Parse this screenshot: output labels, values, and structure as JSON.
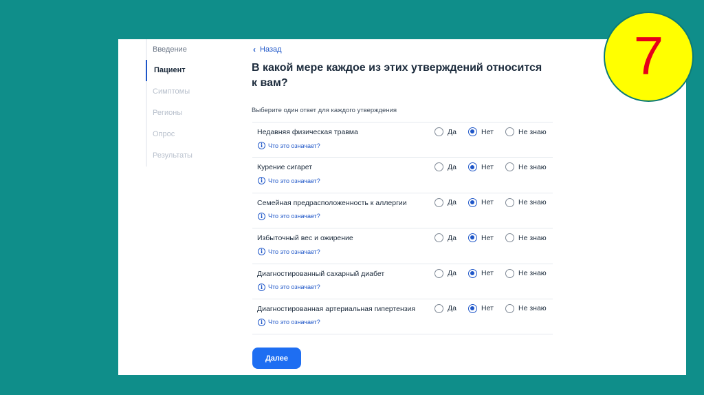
{
  "sidebar": {
    "items": [
      {
        "label": "Введение",
        "state": "done"
      },
      {
        "label": "Пациент",
        "state": "active"
      },
      {
        "label": "Симптомы",
        "state": "pending"
      },
      {
        "label": "Регионы",
        "state": "pending"
      },
      {
        "label": "Опрос",
        "state": "pending"
      },
      {
        "label": "Результаты",
        "state": "pending"
      }
    ]
  },
  "header": {
    "back_label": "Назад",
    "title": "В какой мере каждое из этих утверждений относится к вам?",
    "subtitle": "Выберите один ответ для каждого утверждения"
  },
  "options": {
    "yes": "Да",
    "no": "Нет",
    "dont_know": "Не знаю"
  },
  "help_label": "Что это означает?",
  "questions": [
    {
      "label": "Недавняя физическая травма",
      "selected": "no"
    },
    {
      "label": "Курение сигарет",
      "selected": "no"
    },
    {
      "label": "Семейная предрасположенность к аллергии",
      "selected": "no"
    },
    {
      "label": "Избыточный вес и ожирение",
      "selected": "no"
    },
    {
      "label": "Диагностированный сахарный диабет",
      "selected": "no"
    },
    {
      "label": "Диагностированная артериальная гипертензия",
      "selected": "no"
    }
  ],
  "next_label": "Далее",
  "slide_number": "7",
  "colors": {
    "accent": "#1e56c8",
    "button": "#1e6ef2",
    "background": "#0f8e8a",
    "badge": "#ffff00",
    "badge_text": "#e6001a"
  }
}
